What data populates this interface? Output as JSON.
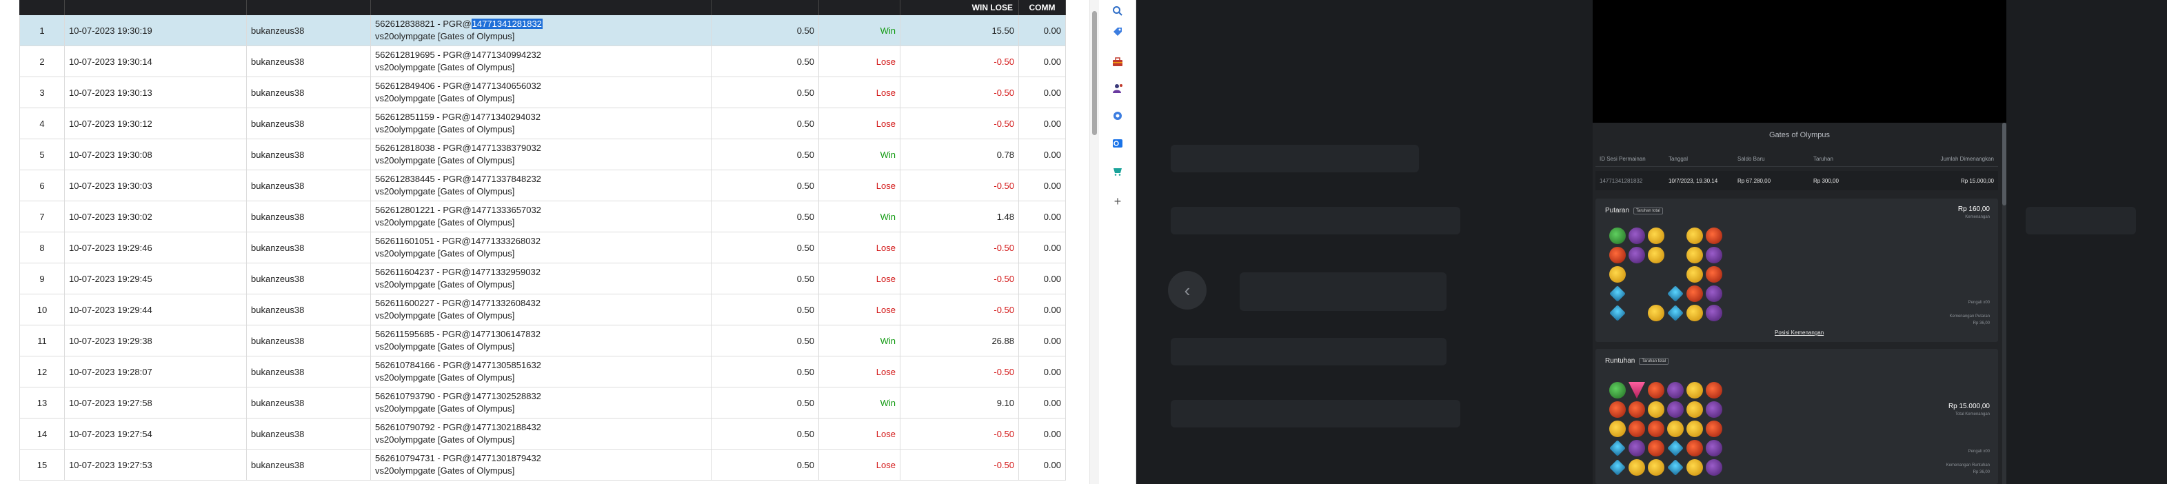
{
  "table": {
    "headers": {
      "win_lose": "WIN LOSE",
      "comm": "COMM"
    },
    "rows": [
      {
        "no": "1",
        "date": "10-07-2023 19:30:19",
        "user": "bukanzeus38",
        "ticket": "562612838821 - PGR@",
        "ticket_highlight": "14771341281832",
        "game": "vs20olympgate [Gates of Olympus]",
        "stake": "0.50",
        "result": "Win",
        "win_lose": "15.50",
        "comm": "0.00",
        "selected": true
      },
      {
        "no": "2",
        "date": "10-07-2023 19:30:14",
        "user": "bukanzeus38",
        "ticket": "562612819695 - PGR@14771340994232",
        "ticket_highlight": "",
        "game": "vs20olympgate [Gates of Olympus]",
        "stake": "0.50",
        "result": "Lose",
        "win_lose": "-0.50",
        "comm": "0.00"
      },
      {
        "no": "3",
        "date": "10-07-2023 19:30:13",
        "user": "bukanzeus38",
        "ticket": "562612849406 - PGR@14771340656032",
        "ticket_highlight": "",
        "game": "vs20olympgate [Gates of Olympus]",
        "stake": "0.50",
        "result": "Lose",
        "win_lose": "-0.50",
        "comm": "0.00"
      },
      {
        "no": "4",
        "date": "10-07-2023 19:30:12",
        "user": "bukanzeus38",
        "ticket": "562612851159 - PGR@14771340294032",
        "ticket_highlight": "",
        "game": "vs20olympgate [Gates of Olympus]",
        "stake": "0.50",
        "result": "Lose",
        "win_lose": "-0.50",
        "comm": "0.00"
      },
      {
        "no": "5",
        "date": "10-07-2023 19:30:08",
        "user": "bukanzeus38",
        "ticket": "562612818038 - PGR@14771338379032",
        "ticket_highlight": "",
        "game": "vs20olympgate [Gates of Olympus]",
        "stake": "0.50",
        "result": "Win",
        "win_lose": "0.78",
        "comm": "0.00"
      },
      {
        "no": "6",
        "date": "10-07-2023 19:30:03",
        "user": "bukanzeus38",
        "ticket": "562612838445 - PGR@14771337848232",
        "ticket_highlight": "",
        "game": "vs20olympgate [Gates of Olympus]",
        "stake": "0.50",
        "result": "Lose",
        "win_lose": "-0.50",
        "comm": "0.00"
      },
      {
        "no": "7",
        "date": "10-07-2023 19:30:02",
        "user": "bukanzeus38",
        "ticket": "562612801221 - PGR@14771333657032",
        "ticket_highlight": "",
        "game": "vs20olympgate [Gates of Olympus]",
        "stake": "0.50",
        "result": "Win",
        "win_lose": "1.48",
        "comm": "0.00"
      },
      {
        "no": "8",
        "date": "10-07-2023 19:29:46",
        "user": "bukanzeus38",
        "ticket": "562611601051 - PGR@14771333268032",
        "ticket_highlight": "",
        "game": "vs20olympgate [Gates of Olympus]",
        "stake": "0.50",
        "result": "Lose",
        "win_lose": "-0.50",
        "comm": "0.00"
      },
      {
        "no": "9",
        "date": "10-07-2023 19:29:45",
        "user": "bukanzeus38",
        "ticket": "562611604237 - PGR@14771332959032",
        "ticket_highlight": "",
        "game": "vs20olympgate [Gates of Olympus]",
        "stake": "0.50",
        "result": "Lose",
        "win_lose": "-0.50",
        "comm": "0.00"
      },
      {
        "no": "10",
        "date": "10-07-2023 19:29:44",
        "user": "bukanzeus38",
        "ticket": "562611600227 - PGR@14771332608432",
        "ticket_highlight": "",
        "game": "vs20olympgate [Gates of Olympus]",
        "stake": "0.50",
        "result": "Lose",
        "win_lose": "-0.50",
        "comm": "0.00"
      },
      {
        "no": "11",
        "date": "10-07-2023 19:29:38",
        "user": "bukanzeus38",
        "ticket": "562611595685 - PGR@14771306147832",
        "ticket_highlight": "",
        "game": "vs20olympgate [Gates of Olympus]",
        "stake": "0.50",
        "result": "Win",
        "win_lose": "26.88",
        "comm": "0.00"
      },
      {
        "no": "12",
        "date": "10-07-2023 19:28:07",
        "user": "bukanzeus38",
        "ticket": "562610784166 - PGR@14771305851632",
        "ticket_highlight": "",
        "game": "vs20olympgate [Gates of Olympus]",
        "stake": "0.50",
        "result": "Lose",
        "win_lose": "-0.50",
        "comm": "0.00"
      },
      {
        "no": "13",
        "date": "10-07-2023 19:27:58",
        "user": "bukanzeus38",
        "ticket": "562610793790 - PGR@14771302528832",
        "ticket_highlight": "",
        "game": "vs20olympgate [Gates of Olympus]",
        "stake": "0.50",
        "result": "Win",
        "win_lose": "9.10",
        "comm": "0.00"
      },
      {
        "no": "14",
        "date": "10-07-2023 19:27:54",
        "user": "bukanzeus38",
        "ticket": "562610790792 - PGR@14771302188432",
        "ticket_highlight": "",
        "game": "vs20olympgate [Gates of Olympus]",
        "stake": "0.50",
        "result": "Lose",
        "win_lose": "-0.50",
        "comm": "0.00"
      },
      {
        "no": "15",
        "date": "10-07-2023 19:27:53",
        "user": "bukanzeus38",
        "ticket": "562610794731 - PGR@14771301879432",
        "ticket_highlight": "",
        "game": "vs20olympgate [Gates of Olympus]",
        "stake": "0.50",
        "result": "Lose",
        "win_lose": "-0.50",
        "comm": "0.00"
      }
    ]
  },
  "side_strip": {
    "icons": [
      "search-icon",
      "tag-icon",
      "toolbox-icon",
      "person-icon",
      "gear-icon",
      "outlook-icon",
      "shopping-icon",
      "plus-icon"
    ]
  },
  "popup": {
    "title": "Gates of Olympus",
    "columns": [
      "ID Sesi Permainan",
      "Tanggal",
      "Saldo Baru",
      "Taruhan",
      "Jumlah Dimenangkan"
    ],
    "row": [
      "14771341281832",
      "10/7/2023, 19.30.14",
      "Rp 67.280,00",
      "Rp 300,00",
      "Rp 15.000,00"
    ],
    "spin": {
      "title": "Putaran",
      "tag": "Taruhan total",
      "amount": "Rp 160,00",
      "amount_sub": "Kemenangan",
      "link": "Posisi Kemenangan",
      "note1": "Pengali x00",
      "note2": "Kemenangan Putaran",
      "note3": "Rp 36,00"
    },
    "tumble": {
      "title": "Runtuhan",
      "tag": "Taruhan total",
      "amount": "Rp 15.000,00",
      "amount_sub": "Total Kemenangan",
      "note1": "Pengali x00",
      "note2": "Kemenangan Runtuhan",
      "note3": "Rp 36,00"
    }
  },
  "colors": {
    "win": "#169c16",
    "lose": "#d31818",
    "highlight": "#1f6fd8",
    "selected_row": "#cfe5ef",
    "header_bg": "#1f2023"
  }
}
